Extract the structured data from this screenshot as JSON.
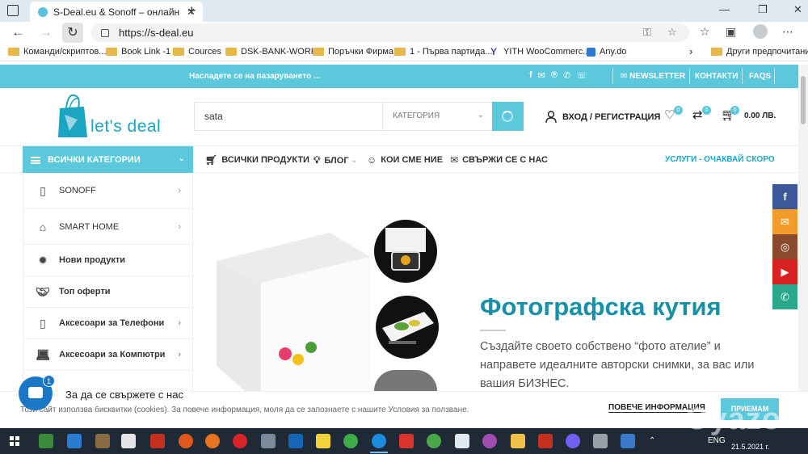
{
  "browser": {
    "tab_title": "S-Deal.eu & Sonoff – онлайн ма",
    "url": "https://s-deal.eu",
    "bookmarks": [
      "Команди/скриптов...",
      "Book Link -1",
      "Cources",
      "DSK-BANK-WORK",
      "Поръчки Фирма",
      "1 - Първа партида...",
      "YITH WooCommerc...",
      "Any.do"
    ],
    "bookmarks_other": "Други предпочитани"
  },
  "site": {
    "promo": "Насладете се на пазаруването ...",
    "top_links": [
      "NEWSLETTER",
      "КОНТАКТИ",
      "FAQS"
    ],
    "logo_text": "let's deal",
    "search_value": "sata",
    "category_placeholder": "КАТЕГОРИЯ",
    "login": "ВХОД / РЕГИСТРАЦИЯ",
    "wishlist_count": "0",
    "compare_count": "0",
    "cart_count": "0",
    "cart_total": "0.00 ЛВ.",
    "all_categories": "ВСИЧКИ КАТЕГОРИИ",
    "menu": {
      "all_products": "ВСИЧКИ ПРОДУКТИ",
      "blog": "БЛОГ",
      "about": "КОИ СМЕ НИЕ",
      "contact": "СВЪРЖИ СЕ С НАС"
    },
    "services": "УСЛУГИ - ОЧАКВАЙ СКОРО",
    "sidebar": [
      {
        "label": "SONOFF",
        "icon": "phone-device-icon"
      },
      {
        "label": "SMART HOME",
        "icon": "smart-home-icon"
      },
      {
        "label": "Нови продукти",
        "icon": "gear-badge-icon"
      },
      {
        "label": "Топ оферти",
        "icon": "handshake-icon"
      },
      {
        "label": "Аксесоари за Телефони",
        "icon": "phone-icon"
      },
      {
        "label": "Аксесоари за Компютри",
        "icon": "laptop-icon"
      }
    ],
    "hero": {
      "title": "Фотографска кутия",
      "description": "Създайте своето собствено “фото ателие” и направете идеалните авторски снимки, за вас или вашия БИЗНЕС."
    },
    "chat": {
      "label": "За да се свържете с нас",
      "badge": "1"
    },
    "cookie": {
      "text": "Този сайт използва бисквитки (cookies). За повече информация, моля да се запознаете с нашите Условия за ползване.",
      "more": "ПОВЕЧЕ ИНФОРМАЦИЯ",
      "accept": "ПРИЕМАМ"
    }
  },
  "taskbar": {
    "lang": "ENG",
    "date": "21.5.2021 г."
  },
  "colors": {
    "accent": "#5bc8dc",
    "title": "#1890a8",
    "facebook": "#3b5998",
    "email": "#f39c2b",
    "instagram": "#8a4a2e",
    "youtube": "#d92121",
    "whatsapp": "#29a88c"
  }
}
